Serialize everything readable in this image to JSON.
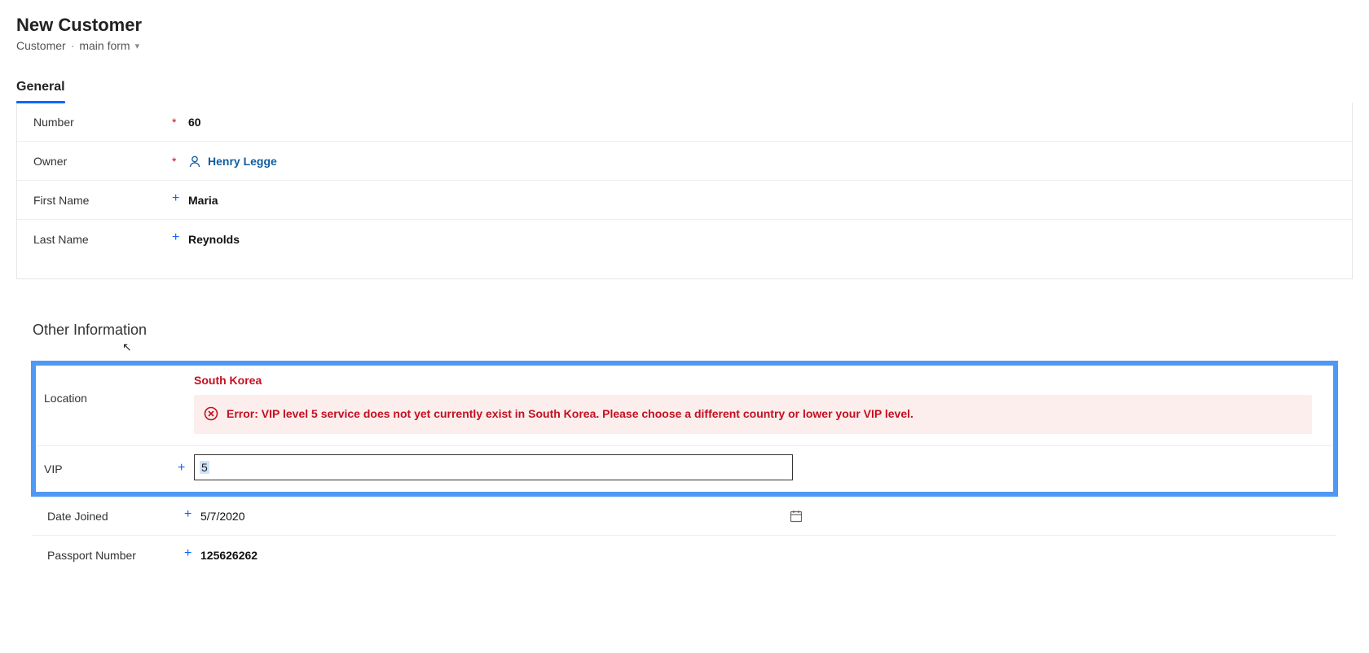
{
  "header": {
    "title": "New Customer",
    "entity": "Customer",
    "form_type": "main form"
  },
  "tabs": {
    "items": [
      {
        "label": "General"
      }
    ]
  },
  "general": {
    "fields": {
      "number": {
        "label": "Number",
        "required": true,
        "value": "60"
      },
      "owner": {
        "label": "Owner",
        "required": true,
        "value": "Henry Legge"
      },
      "first_name": {
        "label": "First Name",
        "required": false,
        "value": "Maria"
      },
      "last_name": {
        "label": "Last Name",
        "required": false,
        "value": "Reynolds"
      }
    }
  },
  "other": {
    "title": "Other Information",
    "location": {
      "label": "Location",
      "required": false,
      "value": "South Korea"
    },
    "error_message": "Error: VIP level 5 service does not yet currently exist in South Korea. Please choose a different country or lower your VIP level.",
    "vip": {
      "label": "VIP",
      "required": false,
      "value": "5"
    },
    "date_joined": {
      "label": "Date Joined",
      "required": false,
      "value": "5/7/2020"
    },
    "passport_number": {
      "label": "Passport Number",
      "required": false,
      "value": "125626262"
    }
  },
  "glyphs": {
    "asterisk": "*",
    "plus": "+",
    "separator": "·"
  }
}
